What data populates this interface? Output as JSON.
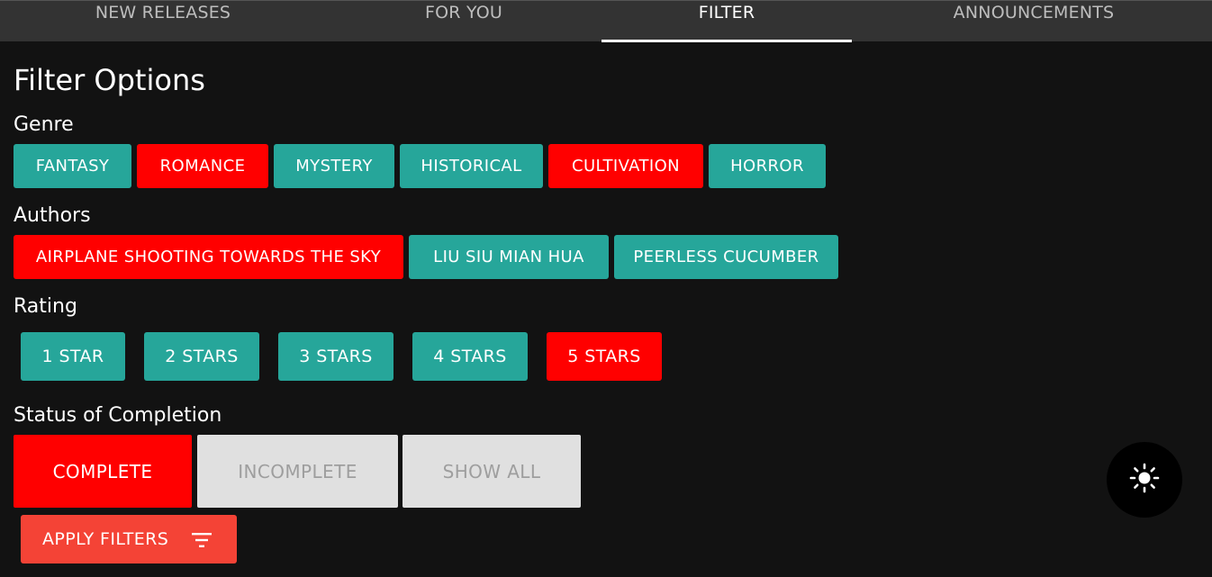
{
  "tabs": [
    {
      "label": "NEW RELEASES"
    },
    {
      "label": "FOR YOU"
    },
    {
      "label": "FILTER",
      "active": true
    },
    {
      "label": "ANNOUNCEMENTS"
    }
  ],
  "page_title": "Filter Options",
  "genre": {
    "label": "Genre",
    "options": [
      {
        "label": "FANTASY",
        "selected": false
      },
      {
        "label": "ROMANCE",
        "selected": true
      },
      {
        "label": "MYSTERY",
        "selected": false
      },
      {
        "label": "HISTORICAL",
        "selected": false
      },
      {
        "label": "CULTIVATION",
        "selected": true
      },
      {
        "label": "HORROR",
        "selected": false
      }
    ]
  },
  "authors": {
    "label": "Authors",
    "options": [
      {
        "label": "AIRPLANE SHOOTING TOWARDS THE SKY",
        "selected": true
      },
      {
        "label": "LIU SIU MIAN HUA",
        "selected": false
      },
      {
        "label": "PEERLESS CUCUMBER",
        "selected": false
      }
    ]
  },
  "rating": {
    "label": "Rating",
    "options": [
      {
        "label": "1 STAR",
        "selected": false
      },
      {
        "label": "2 STARS",
        "selected": false
      },
      {
        "label": "3 STARS",
        "selected": false
      },
      {
        "label": "4 STARS",
        "selected": false
      },
      {
        "label": "5 STARS",
        "selected": true
      }
    ]
  },
  "status": {
    "label": "Status of Completion",
    "options": [
      {
        "label": "COMPLETE",
        "selected": true
      },
      {
        "label": "INCOMPLETE",
        "selected": false
      },
      {
        "label": "SHOW ALL",
        "selected": false
      }
    ]
  },
  "apply_button": {
    "label": "APPLY FILTERS",
    "icon": "filter-icon"
  },
  "theme_toggle": {
    "icon": "sun-icon"
  },
  "colors": {
    "selected": "#ff0000",
    "unselected": "#26a69a",
    "status_unselected": "#e0e0e0",
    "apply": "#f44336",
    "background": "#121212",
    "tabbar": "#333333"
  }
}
